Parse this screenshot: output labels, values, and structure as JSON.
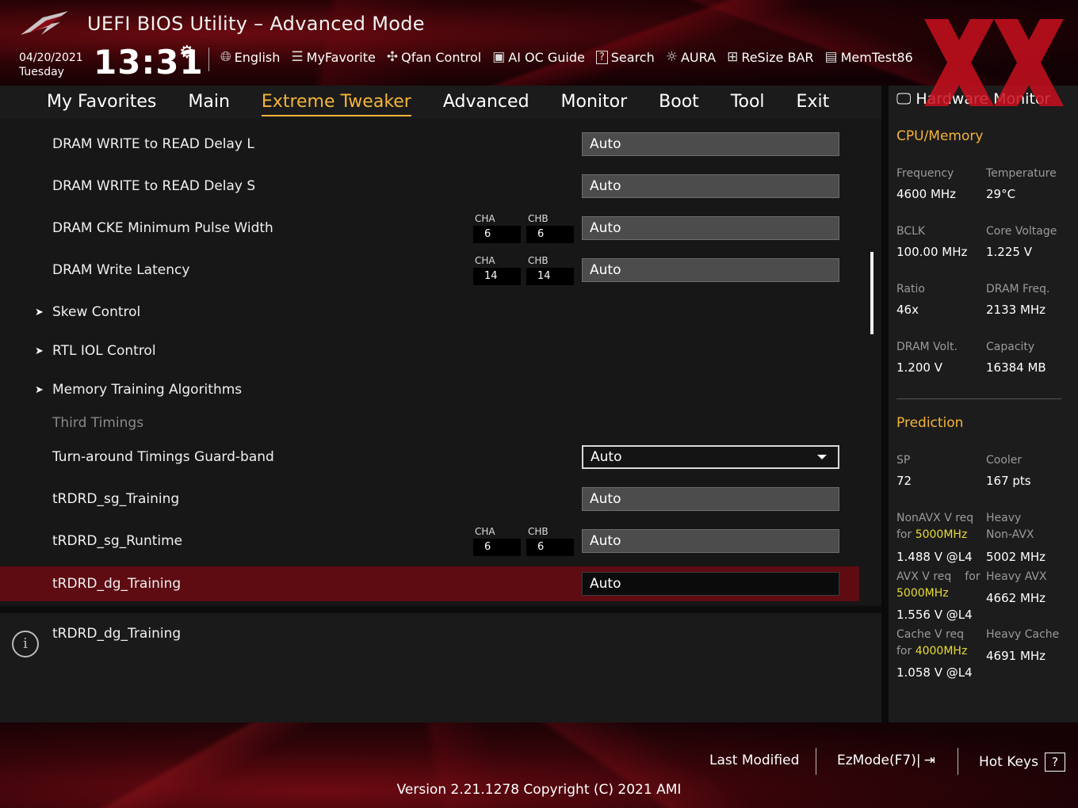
{
  "header": {
    "title": "UEFI BIOS Utility – Advanced Mode",
    "date": "04/20/2021",
    "day": "Tuesday",
    "time": "13:31",
    "toolbar": [
      {
        "label": "English",
        "icon": "globe-icon"
      },
      {
        "label": "MyFavorite",
        "icon": "favorite-list-icon"
      },
      {
        "label": "Qfan Control",
        "icon": "fan-icon"
      },
      {
        "label": "AI OC Guide",
        "icon": "chip-icon"
      },
      {
        "label": "Search",
        "icon": "search-help-icon"
      },
      {
        "label": "AURA",
        "icon": "aura-light-icon"
      },
      {
        "label": "ReSize BAR",
        "icon": "resize-bar-icon"
      },
      {
        "label": "MemTest86",
        "icon": "memtest-icon"
      }
    ]
  },
  "nav": {
    "tabs": [
      "My Favorites",
      "Main",
      "Extreme Tweaker",
      "Advanced",
      "Monitor",
      "Boot",
      "Tool",
      "Exit"
    ],
    "active": "Extreme Tweaker"
  },
  "settings": [
    {
      "label": "DRAM WRITE to READ Delay L",
      "value": "Auto"
    },
    {
      "label": "DRAM WRITE to READ Delay S",
      "value": "Auto"
    },
    {
      "label": "DRAM CKE Minimum Pulse Width",
      "value": "Auto",
      "cha": "6",
      "chb": "6"
    },
    {
      "label": "DRAM Write Latency",
      "value": "Auto",
      "cha": "14",
      "chb": "14"
    },
    {
      "label": "Skew Control",
      "submenu": true
    },
    {
      "label": "RTL IOL Control",
      "submenu": true
    },
    {
      "label": "Memory Training Algorithms",
      "submenu": true
    },
    {
      "label": "Third Timings",
      "section": true
    },
    {
      "label": "Turn-around Timings Guard-band",
      "value": "Auto",
      "dropdown": true
    },
    {
      "label": "tRDRD_sg_Training",
      "value": "Auto"
    },
    {
      "label": "tRDRD_sg_Runtime",
      "value": "Auto",
      "cha": "6",
      "chb": "6"
    },
    {
      "label": "tRDRD_dg_Training",
      "value": "Auto",
      "selected": true
    }
  ],
  "channel_labels": {
    "a": "CHA",
    "b": "CHB"
  },
  "help": {
    "text": "tRDRD_dg_Training"
  },
  "hardware_monitor": {
    "title": "Hardware Monitor",
    "cpu_memory": {
      "heading": "CPU/Memory",
      "items": [
        {
          "key": "Frequency",
          "value": "4600 MHz"
        },
        {
          "key": "Temperature",
          "value": "29°C"
        },
        {
          "key": "BCLK",
          "value": "100.00 MHz"
        },
        {
          "key": "Core Voltage",
          "value": "1.225 V"
        },
        {
          "key": "Ratio",
          "value": "46x"
        },
        {
          "key": "DRAM Freq.",
          "value": "2133 MHz"
        },
        {
          "key": "DRAM Volt.",
          "value": "1.200 V"
        },
        {
          "key": "Capacity",
          "value": "16384 MB"
        }
      ]
    },
    "prediction": {
      "heading": "Prediction",
      "sp_key": "SP",
      "sp_value": "72",
      "cooler_key": "Cooler",
      "cooler_value": "167 pts",
      "nonavx_l1": "NonAVX V req",
      "nonavx_for": "for ",
      "nonavx_freq": "5000MHz",
      "nonavx_value": "1.488 V @L4",
      "heavy_nonavx_l1": "Heavy",
      "heavy_nonavx_l2": "Non-AVX",
      "heavy_nonavx_value": "5002 MHz",
      "avx_l1": "AVX V req",
      "avx_for": "for",
      "avx_freq": "5000MHz",
      "avx_value": "1.556 V @L4",
      "heavy_avx_l1": "Heavy AVX",
      "heavy_avx_value": "4662 MHz",
      "cache_l1": "Cache V req",
      "cache_for": "for ",
      "cache_freq": "4000MHz",
      "cache_value": "1.058 V @L4",
      "heavy_cache_l1": "Heavy Cache",
      "heavy_cache_value": "4691 MHz"
    }
  },
  "footer": {
    "last_modified": "Last Modified",
    "ezmode": "EzMode(F7)|",
    "hot_keys": "Hot Keys",
    "hot_keys_badge": "?",
    "version": "Version 2.21.1278 Copyright (C) 2021 AMI"
  },
  "colors": {
    "accent": "#f4b43a",
    "selection": "#5e0c12",
    "highlight": "#e8dc36"
  }
}
